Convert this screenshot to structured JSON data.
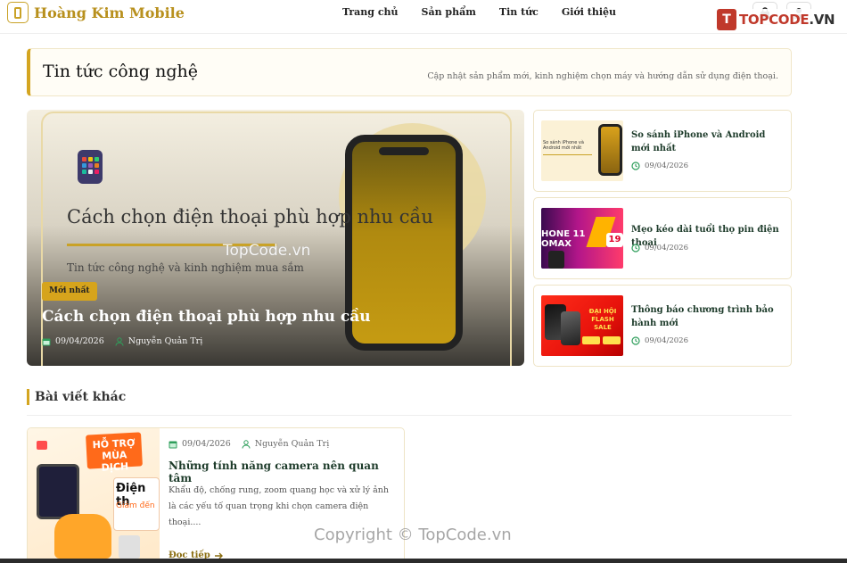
{
  "header": {
    "brand": "Hoàng Kim Mobile",
    "nav": [
      "Trang chủ",
      "Sản phẩm",
      "Tin tức",
      "Giới thiệu"
    ],
    "icons": [
      "phone-logo-icon",
      "shopping-bag-icon",
      "user-icon"
    ]
  },
  "watermarks": {
    "logo_mark": "T",
    "logo_text": "TOPCODE",
    "logo_tld": ".VN",
    "hero": "TopCode.vn",
    "bottom": "Copyright © TopCode.vn"
  },
  "banner": {
    "title": "Tin tức công nghệ",
    "subtitle": "Cập nhật sản phẩm mới, kinh nghiệm chọn máy và hướng dẫn sử dụng điện thoại."
  },
  "hero": {
    "image_title": "Cách chọn điện thoại phù hợp nhu cầu",
    "image_subtitle": "Tin tức công nghệ và kinh nghiệm mua sắm",
    "badge": "Mới nhất",
    "title": "Cách chọn điện thoại phù hợp nhu cầu",
    "date": "09/04/2026",
    "author": "Nguyễn Quản Trị"
  },
  "side_posts": [
    {
      "title": "So sánh iPhone và Android mới nhất",
      "date": "09/04/2026",
      "thumb_text": "So sánh iPhone và Android mới nhất"
    },
    {
      "title": "Mẹo kéo dài tuổi thọ pin điện thoại",
      "date": "09/04/2026",
      "thumb_text": "HONE 11 OMAX"
    },
    {
      "title": "Thông báo chương trình bảo hành mới",
      "date": "09/04/2026",
      "thumb_text": "ĐẠI HỘI FLASH SALE"
    }
  ],
  "section": {
    "title": "Bài viết khác"
  },
  "posts": [
    {
      "date": "09/04/2026",
      "author": "Nguyễn Quản Trị",
      "title": "Những tính năng camera nên quan tâm",
      "excerpt": "Khẩu độ, chống rung, zoom quang học và xử lý ảnh là các yếu tố quan trọng khi chọn camera điện thoại....",
      "more": "Đọc tiếp",
      "thumb_badge": "HỖ TRỢ MÙA DỊCH",
      "thumb_text": "Điện th",
      "thumb_sub": "Giảm đến"
    }
  ],
  "colors": {
    "accent": "#d4a520",
    "title_green": "#1d3b2a",
    "brand": "#b8901d"
  }
}
